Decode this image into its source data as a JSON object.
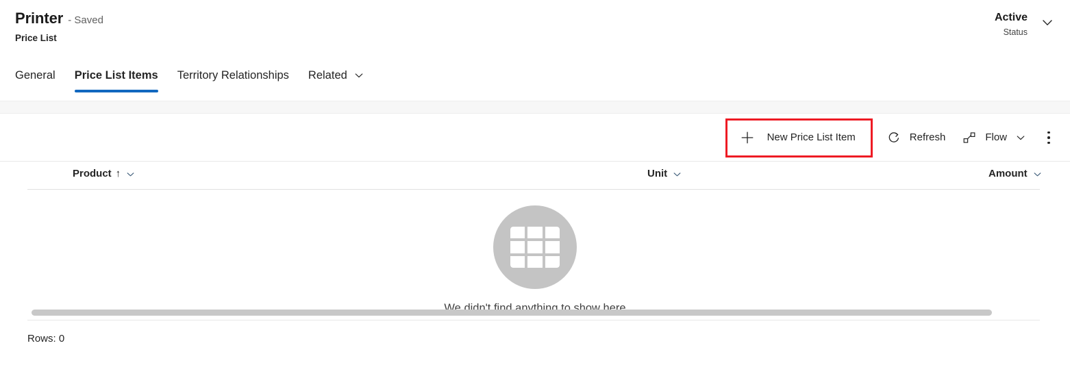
{
  "header": {
    "title": "Printer",
    "saved_state": "- Saved",
    "entity_label": "Price List",
    "status_value": "Active",
    "status_label": "Status",
    "status_chevron_icon": "chevron-down-icon"
  },
  "tabs": [
    {
      "label": "General",
      "selected": false,
      "has_caret": false
    },
    {
      "label": "Price List Items",
      "selected": true,
      "has_caret": false
    },
    {
      "label": "Territory Relationships",
      "selected": false,
      "has_caret": false
    },
    {
      "label": "Related",
      "selected": false,
      "has_caret": true
    }
  ],
  "command_bar": {
    "new_button": {
      "label": "New Price List Item",
      "icon": "plus-icon",
      "highlighted": true,
      "highlight_color": "#ee1b24"
    },
    "refresh_button": {
      "label": "Refresh",
      "icon": "refresh-icon"
    },
    "flow_button": {
      "label": "Flow",
      "icon": "flow-icon",
      "caret_icon": "chevron-down-icon"
    },
    "overflow_button": {
      "icon": "more-vertical-icon"
    }
  },
  "grid": {
    "columns": [
      {
        "label": "Product",
        "sort": "ascending",
        "sort_icon": "arrow-up-icon",
        "caret_icon": "chevron-down-icon"
      },
      {
        "label": "Unit",
        "sort": "none",
        "caret_icon": "chevron-down-icon"
      },
      {
        "label": "Amount",
        "sort": "none",
        "caret_icon": "chevron-down-icon"
      }
    ],
    "rows": [],
    "empty_state": {
      "icon": "table-grid-icon",
      "message": "We didn't find anything to show here"
    },
    "footer": "Rows: 0"
  },
  "colors": {
    "accent": "#1268bf",
    "highlight": "#ee1b24",
    "text": "#242424",
    "muted": "#616161",
    "empty_circle": "#c4c4c4"
  }
}
